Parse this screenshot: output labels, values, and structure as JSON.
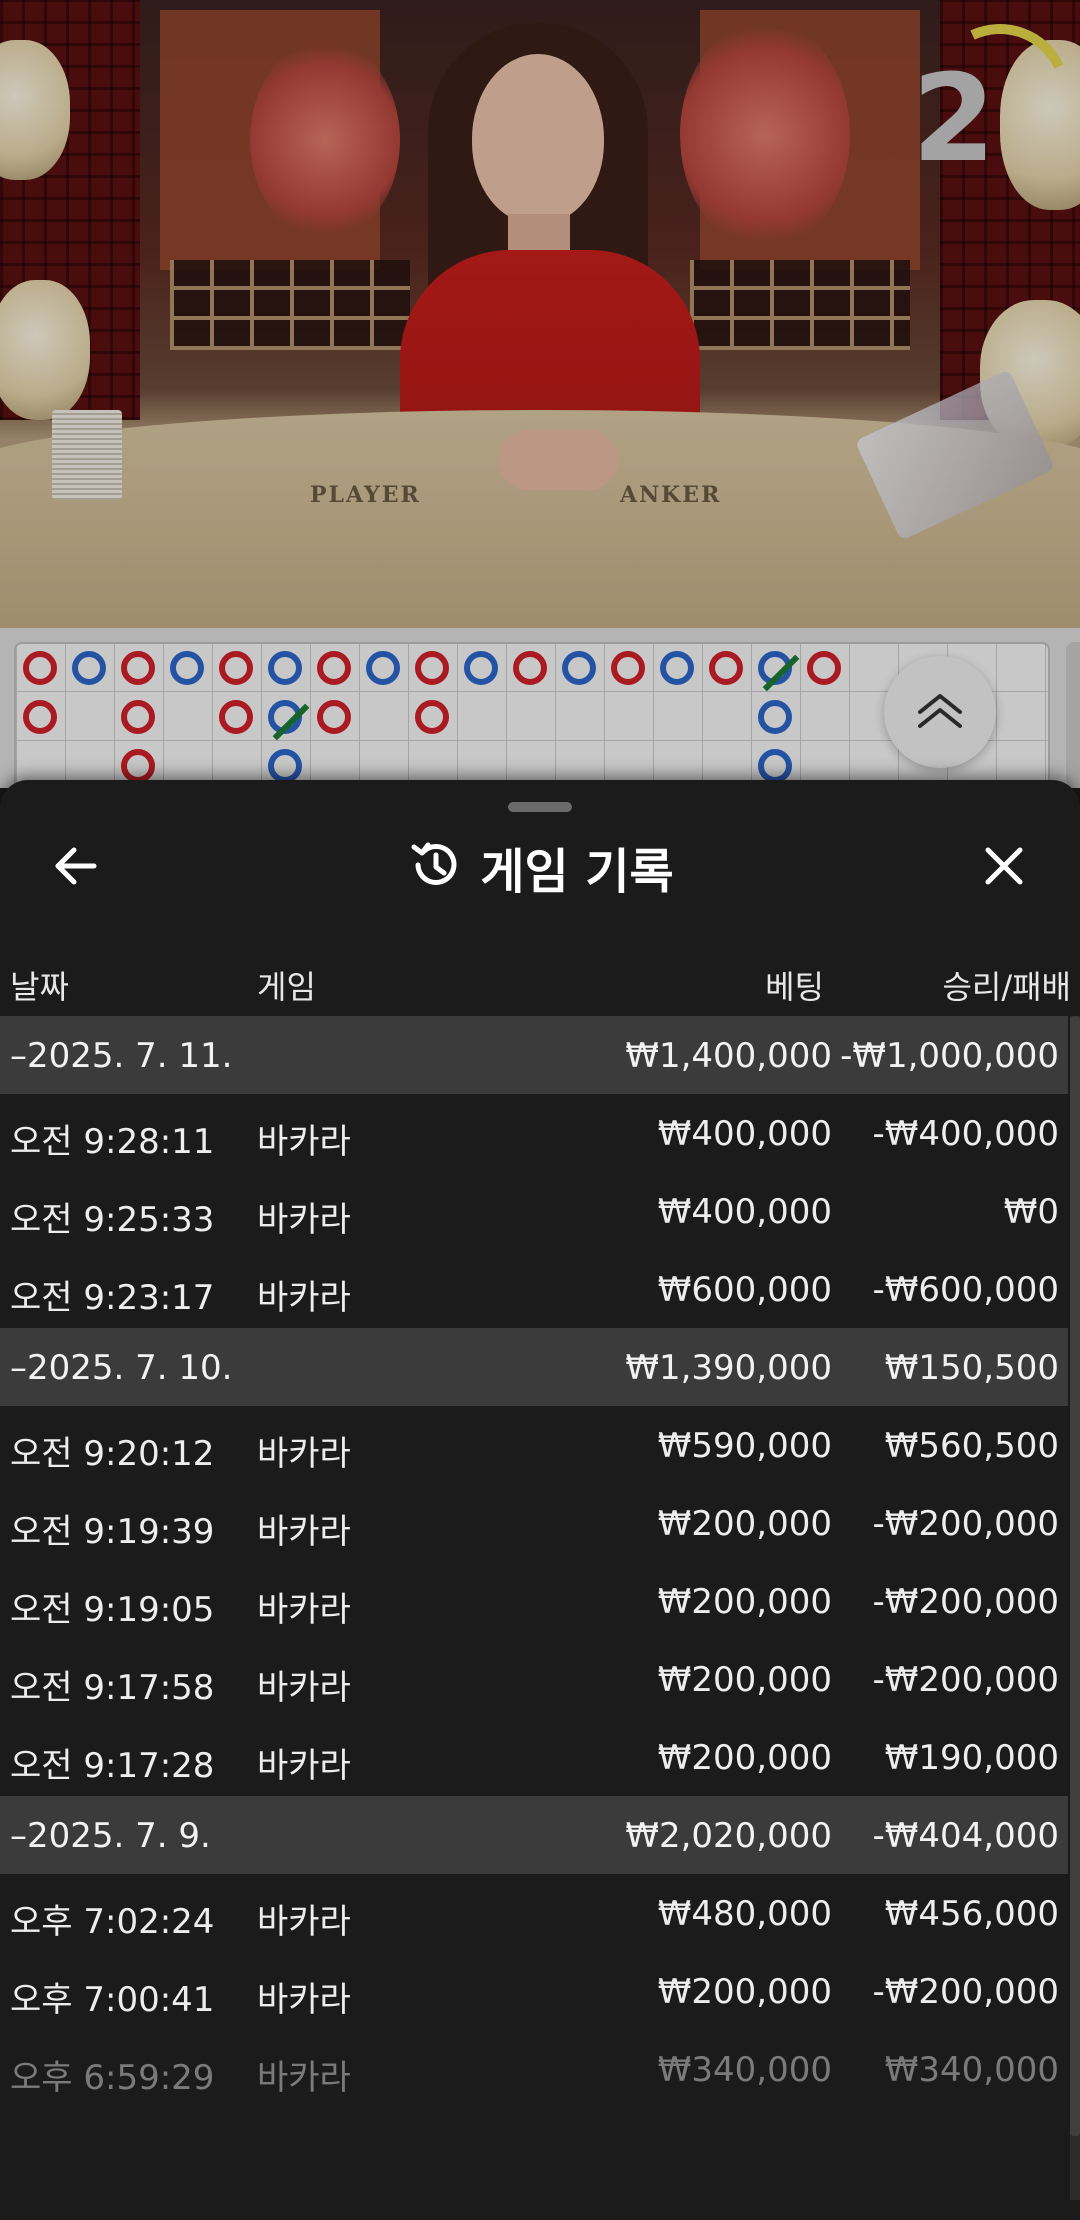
{
  "video": {
    "timer": "2",
    "felt_player": "PLAYER",
    "felt_banker": "ANKER"
  },
  "history": {
    "title": "게임 기록",
    "columns": {
      "date": "날짜",
      "game": "게임",
      "bet": "베팅",
      "win_loss": "승리/패배"
    },
    "rows": [
      {
        "type": "group",
        "date": "–2025. 7. 11.",
        "game": "",
        "bet": "₩1,400,000",
        "win_loss": "-₩1,000,000"
      },
      {
        "type": "item",
        "date": "오전 9:28:11",
        "game": "바카라",
        "bet": "₩400,000",
        "win_loss": "-₩400,000"
      },
      {
        "type": "item",
        "date": "오전 9:25:33",
        "game": "바카라",
        "bet": "₩400,000",
        "win_loss": "₩0"
      },
      {
        "type": "item",
        "date": "오전 9:23:17",
        "game": "바카라",
        "bet": "₩600,000",
        "win_loss": "-₩600,000"
      },
      {
        "type": "group",
        "date": "–2025. 7. 10.",
        "game": "",
        "bet": "₩1,390,000",
        "win_loss": "₩150,500"
      },
      {
        "type": "item",
        "date": "오전 9:20:12",
        "game": "바카라",
        "bet": "₩590,000",
        "win_loss": "₩560,500"
      },
      {
        "type": "item",
        "date": "오전 9:19:39",
        "game": "바카라",
        "bet": "₩200,000",
        "win_loss": "-₩200,000"
      },
      {
        "type": "item",
        "date": "오전 9:19:05",
        "game": "바카라",
        "bet": "₩200,000",
        "win_loss": "-₩200,000"
      },
      {
        "type": "item",
        "date": "오전 9:17:58",
        "game": "바카라",
        "bet": "₩200,000",
        "win_loss": "-₩200,000"
      },
      {
        "type": "item",
        "date": "오전 9:17:28",
        "game": "바카라",
        "bet": "₩200,000",
        "win_loss": "₩190,000"
      },
      {
        "type": "group",
        "date": "–2025. 7. 9.",
        "game": "",
        "bet": "₩2,020,000",
        "win_loss": "-₩404,000"
      },
      {
        "type": "item",
        "date": "오후 7:02:24",
        "game": "바카라",
        "bet": "₩480,000",
        "win_loss": "₩456,000"
      },
      {
        "type": "item",
        "date": "오후 7:00:41",
        "game": "바카라",
        "bet": "₩200,000",
        "win_loss": "-₩200,000"
      },
      {
        "type": "item",
        "date": "오후 6:59:29",
        "game": "바카라",
        "bet": "₩340,000",
        "win_loss": "₩340,000"
      }
    ]
  },
  "roadmap": {
    "beads": [
      {
        "col": 0,
        "row": 0,
        "color": "red"
      },
      {
        "col": 1,
        "row": 0,
        "color": "blue"
      },
      {
        "col": 2,
        "row": 0,
        "color": "red"
      },
      {
        "col": 3,
        "row": 0,
        "color": "blue"
      },
      {
        "col": 4,
        "row": 0,
        "color": "red"
      },
      {
        "col": 5,
        "row": 0,
        "color": "blue"
      },
      {
        "col": 6,
        "row": 0,
        "color": "red"
      },
      {
        "col": 7,
        "row": 0,
        "color": "blue"
      },
      {
        "col": 8,
        "row": 0,
        "color": "red"
      },
      {
        "col": 9,
        "row": 0,
        "color": "blue"
      },
      {
        "col": 10,
        "row": 0,
        "color": "red"
      },
      {
        "col": 11,
        "row": 0,
        "color": "blue"
      },
      {
        "col": 12,
        "row": 0,
        "color": "red"
      },
      {
        "col": 13,
        "row": 0,
        "color": "blue"
      },
      {
        "col": 14,
        "row": 0,
        "color": "red"
      },
      {
        "col": 15,
        "row": 0,
        "color": "blue",
        "tie": true
      },
      {
        "col": 16,
        "row": 0,
        "color": "red"
      },
      {
        "col": 0,
        "row": 1,
        "color": "red"
      },
      {
        "col": 2,
        "row": 1,
        "color": "red"
      },
      {
        "col": 4,
        "row": 1,
        "color": "red"
      },
      {
        "col": 5,
        "row": 1,
        "color": "blue",
        "tie": true
      },
      {
        "col": 6,
        "row": 1,
        "color": "red"
      },
      {
        "col": 8,
        "row": 1,
        "color": "red"
      },
      {
        "col": 15,
        "row": 1,
        "color": "blue"
      },
      {
        "col": 2,
        "row": 2,
        "color": "red"
      },
      {
        "col": 5,
        "row": 2,
        "color": "blue"
      },
      {
        "col": 15,
        "row": 2,
        "color": "blue"
      }
    ]
  },
  "colors": {
    "red_bead": "#d0202a",
    "blue_bead": "#2e66c9",
    "tie_mark": "#1b7a35",
    "sheet_bg": "#1b1b1b",
    "group_row_bg": "#3b3b3b"
  },
  "icons": {
    "back": "arrow-left-icon",
    "history": "history-icon",
    "close": "close-icon",
    "scroll_up": "double-chevron-up-icon"
  }
}
